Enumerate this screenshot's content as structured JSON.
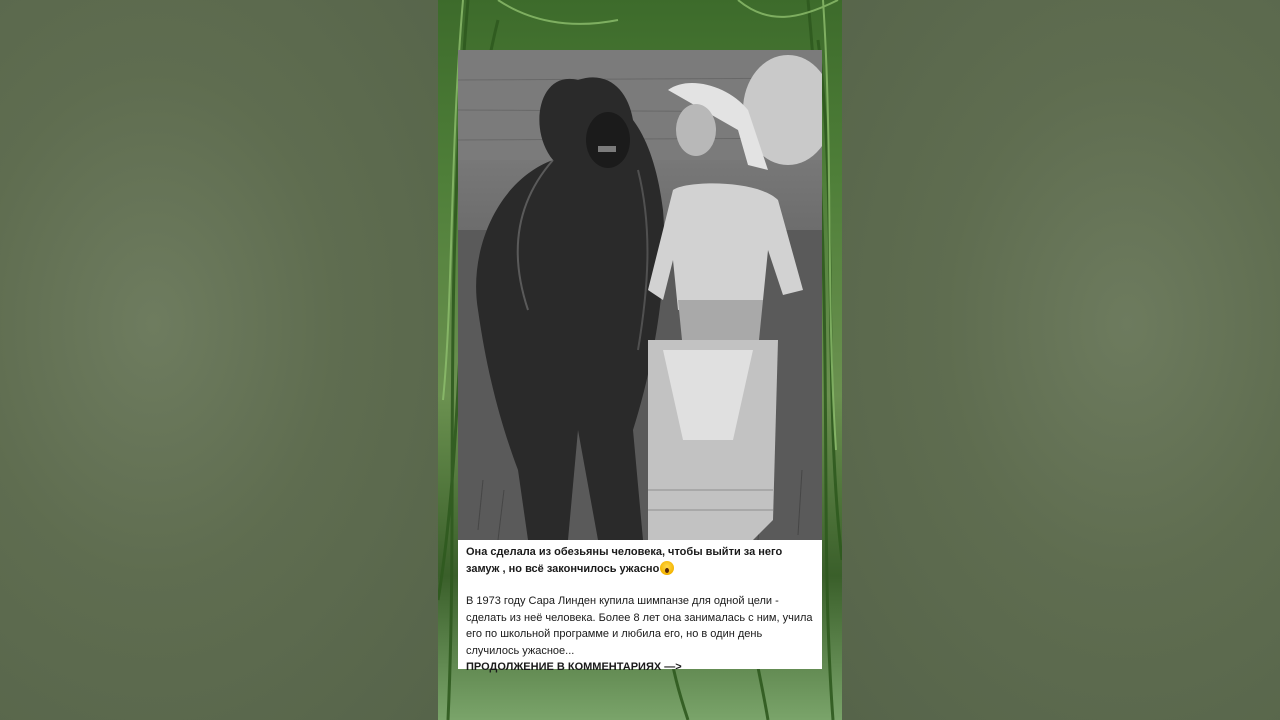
{
  "post": {
    "headline": "Она сделала из обезьяны человека, чтобы выйти за него замуж , но всё закончилось ужасно",
    "headline_emoji": "scream-emoji",
    "body": "В 1973 году Сара Линден купила шимпанзе для одной цели - сделать из неё человека. Более 8 лет она занималась с ним, учила его по школьной программе  и любила его, но в один день случилось ужасное...",
    "more": "ПРОДОЛЖЕНИЕ В КОММЕНТАРИЯХ —>"
  },
  "colors": {
    "side_background": "#5e6b4e",
    "foliage": "#4f7f39",
    "card_background": "#ffffff",
    "text": "#1a1a1a"
  }
}
